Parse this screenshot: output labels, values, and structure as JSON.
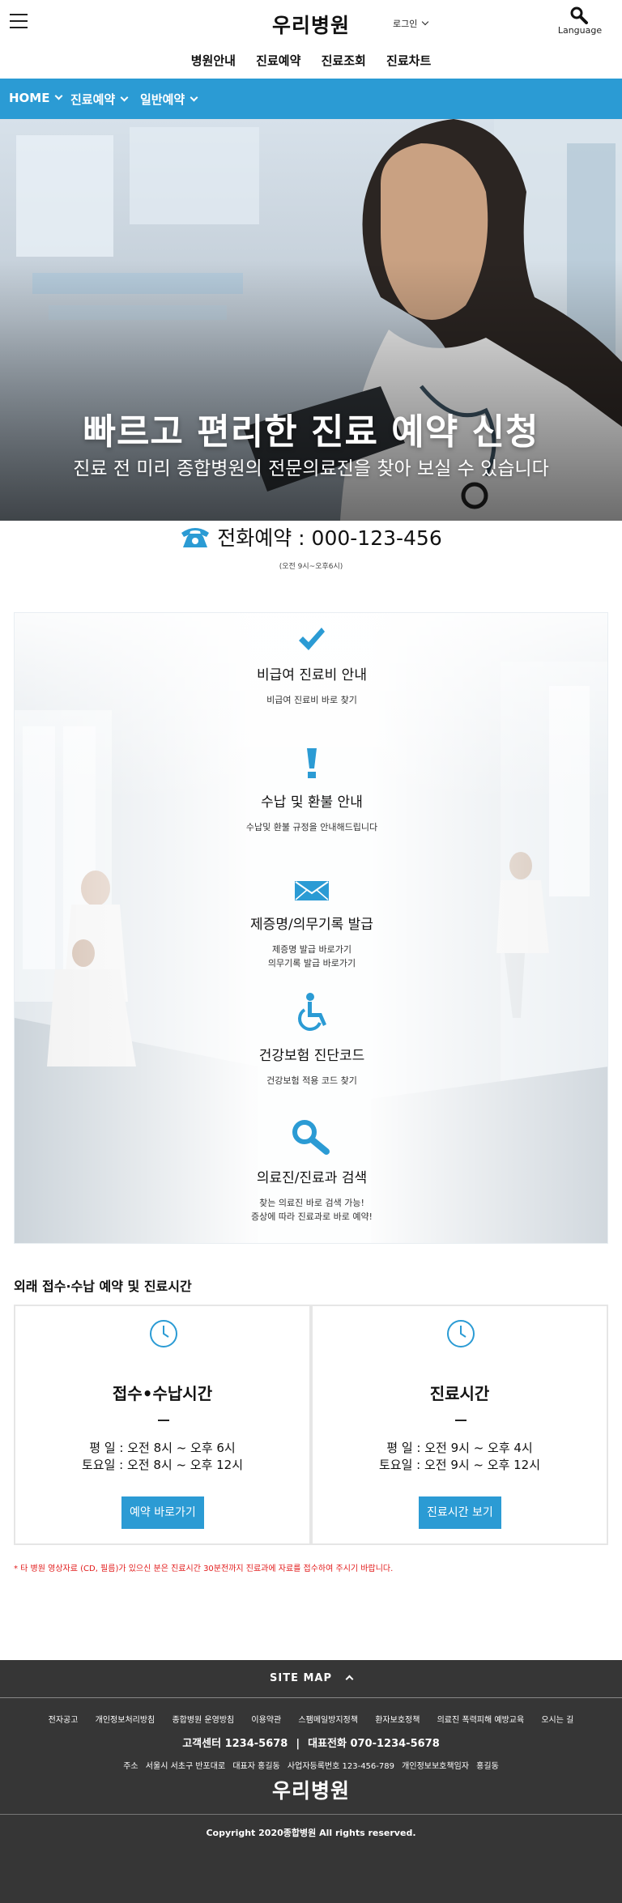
{
  "header": {
    "site_logo": "우리병원",
    "login_label": "로그인",
    "language_label": "Language",
    "main_nav": [
      "병원안내",
      "진료예약",
      "진료조회",
      "진료차트"
    ]
  },
  "breadcrumb": [
    "HOME",
    "진료예약",
    "일반예약"
  ],
  "hero": {
    "title": "빠르고 편리한 진료 예약 신청",
    "subtitle": "진료 전 미리 종합병원의 전문의료진을 찾아 보실 수 있습니다"
  },
  "phone": {
    "label": "전화예약 : 000-123-456",
    "hours": "(오전 9시~오후6시)"
  },
  "services": [
    {
      "icon": "check-icon",
      "title": "비급여 진료비 안내",
      "desc": [
        "비급여 진료비 바로 찾기"
      ]
    },
    {
      "icon": "exclamation-icon",
      "title": "수납 및 환불 안내",
      "desc": [
        "수납및 환불 규정을 안내해드립니다"
      ]
    },
    {
      "icon": "envelope-icon",
      "title": "제증명/의무기록 발급",
      "desc": [
        "제증명 발급 바로가기",
        "의무기록 발급 바로가기"
      ]
    },
    {
      "icon": "wheelchair-icon",
      "title": "건강보험 진단코드",
      "desc": [
        "건강보험 적용 코드 찾기"
      ]
    },
    {
      "icon": "search-icon",
      "title": "의료진/진료과 검색",
      "desc": [
        "찾는 의료진 바로 검색 가능!",
        "증상에 따라 진료과로 바로 예약!"
      ]
    }
  ],
  "hours_section": {
    "title": "외래 접수·수납 예약 및 진료시간",
    "cards": [
      {
        "title": "접수•수납시간",
        "rows": [
          "평 일 : 오전 8시 ~ 오후 6시",
          "토요일 : 오전 8시 ~ 오후 12시"
        ],
        "button": "예약 바로가기"
      },
      {
        "title": "진료시간",
        "rows": [
          "평 일 : 오전 9시 ~ 오후 4시",
          "토요일 : 오전 9시 ~ 오후 12시"
        ],
        "button": "진료시간 보기"
      }
    ],
    "notice": "* 타 병원 영상자료 (CD, 필름)가 있으신 분은 진료시간 30분전까지 진료과에 자료를 접수하여 주시기 바랍니다."
  },
  "footer": {
    "sitemap_label": "SITE MAP",
    "links": [
      "전자공고",
      "개인정보처리방침",
      "종합병원 운영방침",
      "이용약관",
      "스팸메일방지정책",
      "환자보호정책",
      "의료진 폭력피해 예방교육",
      "오시는 길"
    ],
    "customer_center": "고객센터 1234-5678",
    "main_phone": "대표전화 070-1234-5678",
    "address": [
      "주소",
      "서울시 서초구 반포대로",
      "대표자 홍길동",
      "사업자등록번호 123-456-789",
      "개인정보보호책임자",
      "홍길동"
    ],
    "logo": "우리병원",
    "copyright": "Copyright 2020종합병원 All rights reserved."
  },
  "colors": {
    "accent": "#2b9bd4",
    "footer_bg": "#363636",
    "notice": "#e21c1c"
  }
}
